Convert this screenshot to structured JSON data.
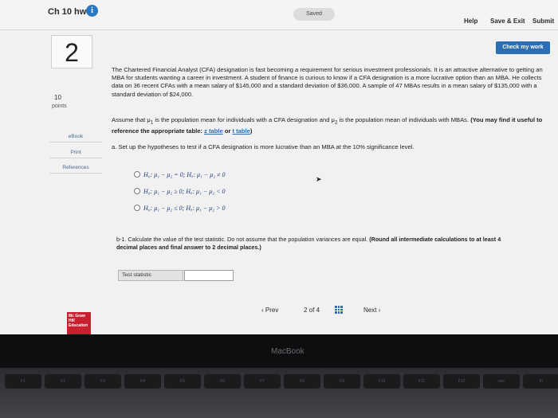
{
  "header": {
    "assignment_title": "Ch 10 hw",
    "info_icon": "i",
    "status": "Saved",
    "help_label": "Help",
    "save_exit_label": "Save & Exit",
    "submit_label": "Submit"
  },
  "question": {
    "number": "2",
    "points_value": "10",
    "points_label": "points",
    "check_label": "Check my work",
    "resources": {
      "ebook": "eBook",
      "print": "Print",
      "references": "References"
    },
    "prompt": "The Chartered Financial Analyst (CFA) designation is fast becoming a requirement for serious investment professionals. It is an attractive alternative to getting an MBA for students wanting a career in investment. A student of finance is curious to know if a CFA designation is a more lucrative option than an MBA. He collects data on 36 recent CFAs with a mean salary of $145,000 and a standard deviation of $36,000. A sample of 47 MBAs results in a mean salary of $135,000 with a standard deviation of $24,000.",
    "assume_1": "Assume that μ",
    "assume_sub1": "1",
    "assume_2": " is the population mean for individuals with a CFA designation and μ",
    "assume_sub2": "2",
    "assume_3": " is the population mean of individuals with MBAs. ",
    "assume_bold": "(You may find it useful to reference the appropriate table: ",
    "z_table": "z table",
    "or": " or ",
    "t_table": "t table",
    "close_paren": ")",
    "part_a": "a. Set up the hypotheses to test if a CFA designation is more lucrative than an MBA at the 10% significance level.",
    "options": [
      "H₀: μ₁ − μ₂ = 0; Hₐ: μ₁ − μ₂ ≠ 0",
      "H₀: μ₁ − μ₂ ≥ 0; Hₐ: μ₁ − μ₂ < 0",
      "H₀: μ₁ − μ₂ ≤ 0; Hₐ: μ₁ − μ₂ > 0"
    ],
    "part_b1": "b-1. Calculate the value of the test statistic. Do not assume that the population variances are equal. ",
    "part_b1_bold": "(Round all intermediate calculations to at least 4 decimal places and final answer to 2 decimal places.)",
    "test_stat_label": "Test statistic",
    "test_stat_value": ""
  },
  "pager": {
    "prev": "‹  Prev",
    "page_indicator": "2  of  4",
    "next": "Next  ›"
  },
  "logo_text": "Mc Graw Hill Education",
  "laptop_brand": "MacBook",
  "keys": [
    "F1",
    "F2",
    "F3",
    "F4",
    "F5",
    "F6",
    "F7",
    "F8",
    "F9",
    "F10",
    "F11",
    "F12",
    "esc",
    "fn"
  ]
}
